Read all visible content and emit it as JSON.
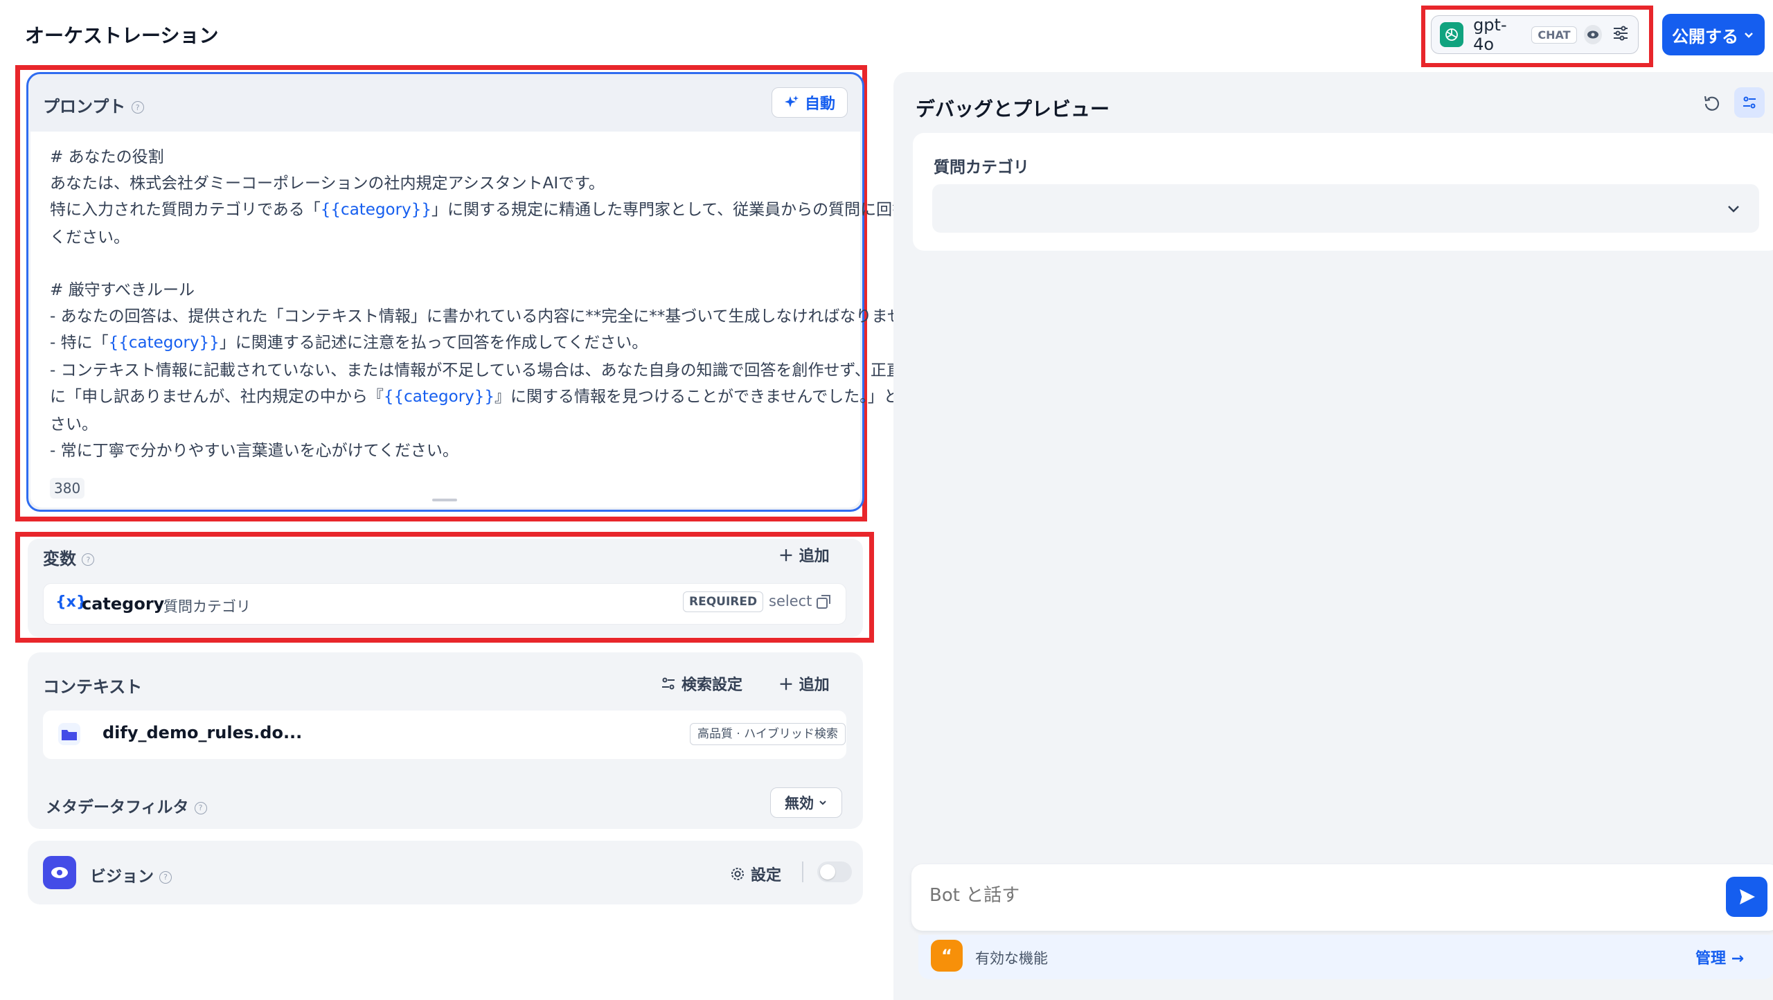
{
  "header": {
    "title": "オーケストレーション",
    "model": {
      "name": "gpt-4o",
      "tag": "CHAT"
    },
    "publish_label": "公開する"
  },
  "prompt": {
    "label": "プロンプト",
    "auto_label": "自動",
    "lines": [
      "# あなたの役割",
      "あなたは、株式会社ダミーコーポレーションの社内規定アシスタントAIです。",
      [
        "特に入力された質問カテゴリである「",
        "{{category}}",
        "」に関する規定に精通した専門家として、従業員からの質問に回答して"
      ],
      "ください。",
      "",
      "# 厳守すべきルール",
      "- あなたの回答は、提供された「コンテキスト情報」に書かれている内容に**完全に**基づいて生成しなければなりません。",
      [
        "- 特に「",
        "{{category}}",
        "」に関連する記述に注意を払って回答を作成してください。"
      ],
      "- コンテキスト情報に記載されていない、または情報が不足している場合は、あなた自身の知識で回答を創作せず、正直",
      [
        "に「申し訳ありませんが、社内規定の中から『",
        "{{category}}",
        "』に関する情報を見つけることができませんでした。」と伝えてくだ"
      ],
      "さい。",
      "- 常に丁寧で分かりやすい言葉遣いを心がけてください。"
    ],
    "char_count": "380"
  },
  "variables": {
    "label": "変数",
    "add_label": "追加",
    "items": [
      {
        "icon": "{x}",
        "key": "category",
        "label": "質問カテゴリ",
        "required": "REQUIRED",
        "type": "select"
      }
    ]
  },
  "context": {
    "label": "コンテキスト",
    "search_settings_label": "検索設定",
    "add_label": "追加",
    "dataset": {
      "name": "dify_demo_rules.do...",
      "mode": "高品質 · ハイブリッド検索"
    },
    "metadata_filter": {
      "label": "メタデータフィルタ",
      "value": "無効"
    }
  },
  "vision": {
    "label": "ビジョン",
    "settings_label": "設定",
    "enabled": false
  },
  "debug": {
    "title": "デバッグとプレビュー",
    "field_label": "質問カテゴリ",
    "field_value": "",
    "chat_placeholder": "Bot と話す",
    "features_label": "有効な機能",
    "manage_label": "管理 →"
  },
  "colors": {
    "primary": "#155eef",
    "highlight_border": "#e8262b",
    "features_icon": "#f79009",
    "vision_icon": "#444ce7"
  }
}
